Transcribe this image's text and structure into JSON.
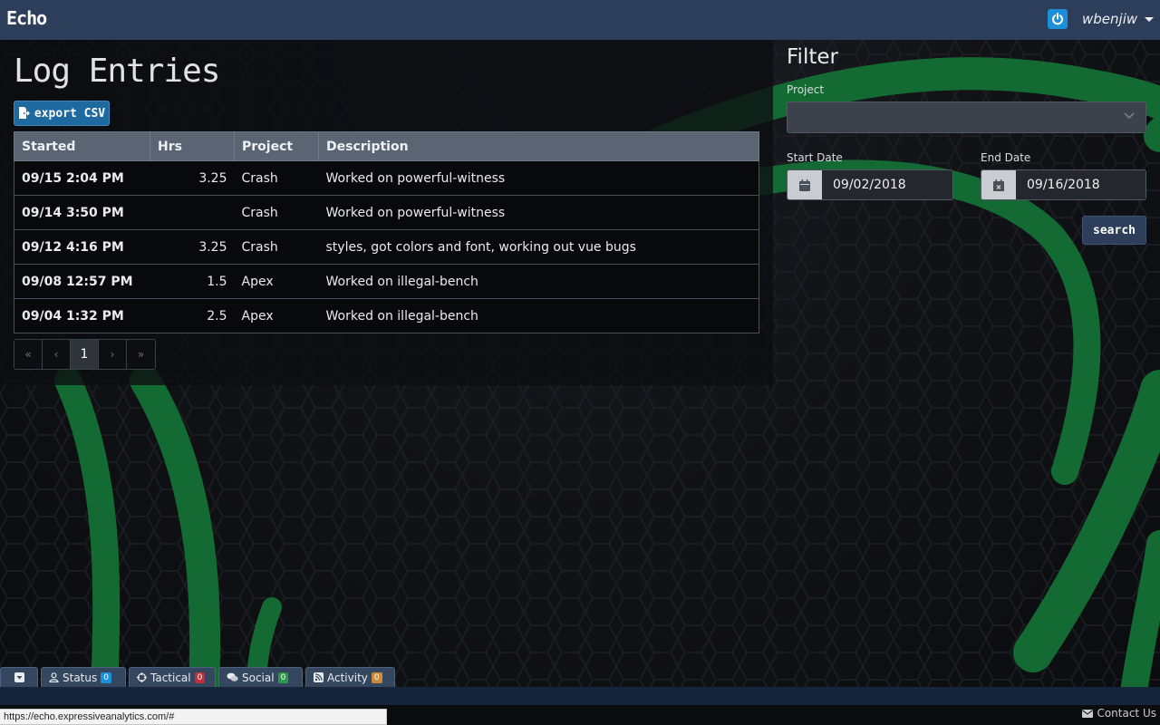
{
  "app": {
    "brand": "Echo"
  },
  "user": {
    "name": "wbenjiw"
  },
  "log": {
    "title": "Log Entries",
    "export_label": "export CSV",
    "columns": {
      "started": "Started",
      "hrs": "Hrs",
      "project": "Project",
      "description": "Description"
    },
    "rows": [
      {
        "started": "09/15 2:04 PM",
        "hrs": "3.25",
        "project": "Crash",
        "description": "Worked on powerful-witness"
      },
      {
        "started": "09/14 3:50 PM",
        "hrs": "",
        "project": "Crash",
        "description": "Worked on powerful-witness"
      },
      {
        "started": "09/12 4:16 PM",
        "hrs": "3.25",
        "project": "Crash",
        "description": "styles, got colors and font, working out vue bugs"
      },
      {
        "started": "09/08 12:57 PM",
        "hrs": "1.5",
        "project": "Apex",
        "description": "Worked on illegal-bench"
      },
      {
        "started": "09/04 1:32 PM",
        "hrs": "2.5",
        "project": "Apex",
        "description": "Worked on illegal-bench"
      }
    ],
    "pagination": {
      "first": "«",
      "prev": "‹",
      "current": "1",
      "next": "›",
      "last": "»"
    }
  },
  "filter": {
    "title": "Filter",
    "project_label": "Project",
    "project_value": "",
    "start_label": "Start Date",
    "start_value": "09/02/2018",
    "end_label": "End Date",
    "end_value": "09/16/2018",
    "search_label": "search"
  },
  "tabs": [
    {
      "label": "Status",
      "count": "0",
      "color": "#1b8fd8"
    },
    {
      "label": "Tactical",
      "count": "0",
      "color": "#c0303a"
    },
    {
      "label": "Social",
      "count": "0",
      "color": "#2a9a48"
    },
    {
      "label": "Activity",
      "count": "0",
      "color": "#c98a3a"
    }
  ],
  "footer": {
    "contact": "Contact Us",
    "status_url": "https://echo.expressiveanalytics.com/#"
  },
  "colors": {
    "navbar": "#2c3e5a",
    "accent_green": "#1e7a3c",
    "export": "#1e6aa0"
  }
}
